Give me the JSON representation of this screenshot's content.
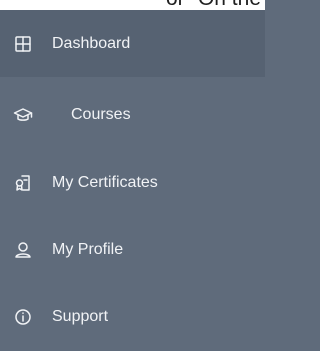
{
  "header": {
    "overflow_text": "or \"On the side"
  },
  "sidebar": {
    "items": [
      {
        "label": "Dashboard",
        "icon": "grid-icon",
        "active": true
      },
      {
        "label": "Courses",
        "icon": "graduation-cap-icon",
        "active": false
      },
      {
        "label": "My Certificates",
        "icon": "certificate-icon",
        "active": false
      },
      {
        "label": "My Profile",
        "icon": "user-icon",
        "active": false
      },
      {
        "label": "Support",
        "icon": "info-icon",
        "active": false
      }
    ]
  },
  "colors": {
    "sidebar_bg": "#5f6b7b",
    "active_bg": "#566272",
    "text": "#f1f3f6"
  }
}
